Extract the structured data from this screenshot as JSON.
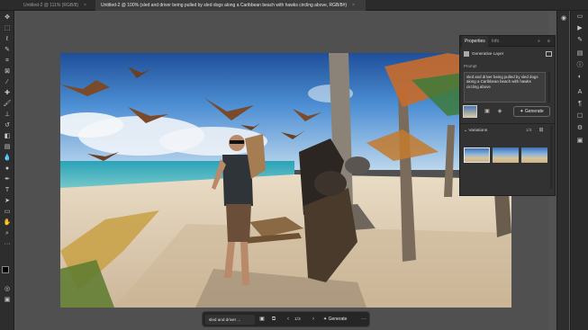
{
  "tabs": [
    {
      "label": "Untitled-2 @ 111% (RGB/8)",
      "close": "×"
    },
    {
      "label": "Untitled-2 @ 100% (sled and driver being pulled by sled dogs along a Caribbean beach with hawks circling above, RGB/8#)",
      "close": "×"
    }
  ],
  "properties_panel": {
    "tab_properties": "Properties",
    "tab_info": "Info",
    "layer_type": "Generative Layer",
    "prompt_label": "Prompt",
    "prompt_text": "sled and driver being pulled by sled dogs along a Caribbean beach with hawks circling above",
    "generate_label": "Generate",
    "variations_label": "Variations",
    "variations_count": "1/3"
  },
  "context_bar": {
    "prompt_preview": "sled and driver ...",
    "counter": "1/3",
    "generate_label": "Generate",
    "more": "···"
  },
  "icons": {
    "toolbar": [
      "move-icon",
      "marquee-icon",
      "lasso-icon",
      "quick-select-icon",
      "crop-icon",
      "frame-icon",
      "eyedropper-icon",
      "healing-icon",
      "brush-icon",
      "stamp-icon",
      "history-brush-icon",
      "eraser-icon",
      "gradient-icon",
      "blur-icon",
      "dodge-icon",
      "pen-icon",
      "type-icon",
      "path-select-icon",
      "shape-icon",
      "hand-icon",
      "zoom-icon"
    ]
  },
  "colors": {
    "ui_dark": "#2b2b2b",
    "panel": "#323232",
    "canvas_bg": "#505050",
    "accent_blue": "#3d8fe0"
  }
}
